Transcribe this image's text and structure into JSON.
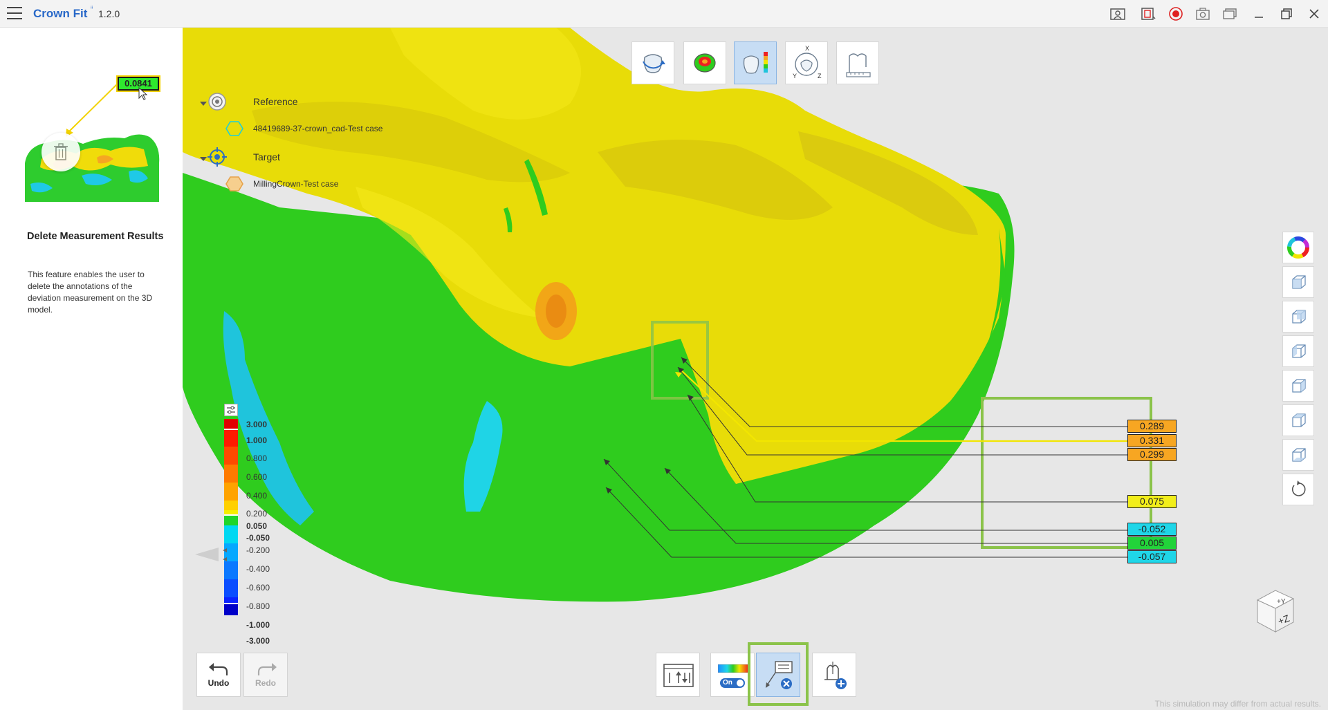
{
  "app": {
    "title": "Crown Fit",
    "superscript": "ⁱⁱ",
    "version": "1.2.0"
  },
  "tutorial": {
    "callout_value": "0.0841",
    "title": "Delete Measurement Results",
    "description": "This feature enables the user to delete the annotations of the deviation measurement on the 3D model."
  },
  "tree": {
    "reference_label": "Reference",
    "reference_item": "48419689-37-crown_cad-Test case",
    "target_label": "Target",
    "target_item": "MillingCrown-Test case"
  },
  "color_scale": {
    "labels": [
      "3.000",
      "1.000",
      "0.800",
      "0.600",
      "0.400",
      "0.200",
      "0.050",
      "-0.050",
      "-0.200",
      "-0.400",
      "-0.600",
      "-0.800",
      "-1.000",
      "-3.000"
    ],
    "colors": [
      "#e00000",
      "#ff1a00",
      "#ff4a00",
      "#ff7a00",
      "#ffa300",
      "#ffd000",
      "#f6ee00",
      "#1fd62a",
      "#00d8f2",
      "#06a8ff",
      "#0a78ff",
      "#0a4dff",
      "#0a22ff",
      "#0000c8"
    ]
  },
  "measurements": [
    {
      "value": "0.289",
      "color": "#f7a622"
    },
    {
      "value": "0.331",
      "color": "#f7a622"
    },
    {
      "value": "0.299",
      "color": "#f7a622"
    },
    {
      "value": "0.075",
      "color": "#f2ee1a"
    },
    {
      "value": "-0.052",
      "color": "#1fd6e8"
    },
    {
      "value": "0.005",
      "color": "#22d33a"
    },
    {
      "value": "-0.057",
      "color": "#1fd6e8"
    }
  ],
  "buttons": {
    "undo": "Undo",
    "redo": "Redo",
    "toggle_on": "On"
  },
  "footnote": "This simulation may differ from actual results."
}
